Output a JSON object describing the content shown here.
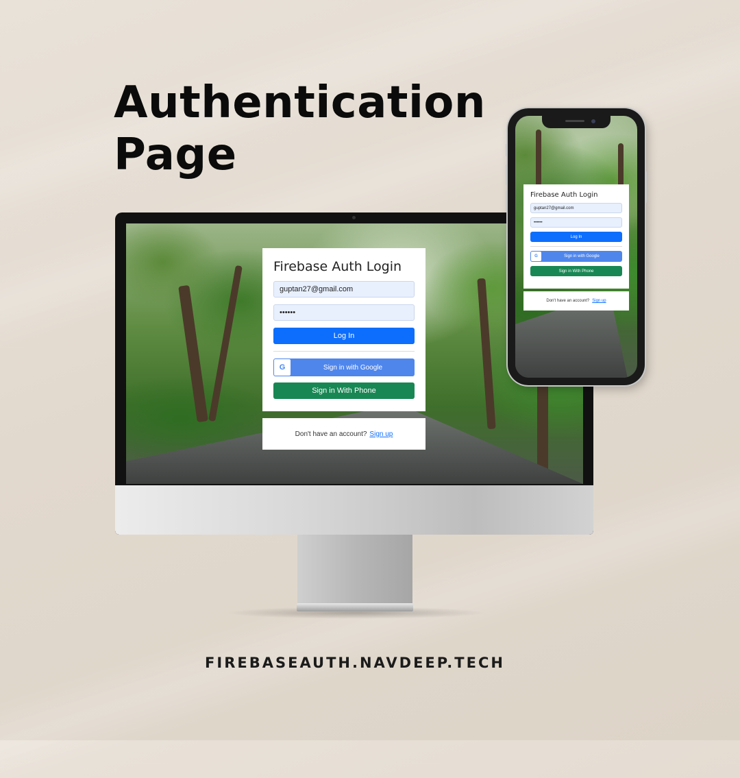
{
  "headline": {
    "line1": "Authentication",
    "line2": "Page"
  },
  "footer": {
    "url": "FIREBASEAUTH.NAVDEEP.TECH"
  },
  "login": {
    "title": "Firebase Auth Login",
    "email_value": "guptan27@gmail.com",
    "password_value": "••••••",
    "login_label": "Log In",
    "google_label": "Sign in with Google",
    "google_icon_letter": "G",
    "phone_label": "Sign in With Phone",
    "signup_prompt": "Don't have an account?",
    "signup_link": "Sign up"
  },
  "colors": {
    "primary": "#0d6efd",
    "google": "#4f86ec",
    "phone": "#198754",
    "field_bg": "#e8f0fe"
  }
}
